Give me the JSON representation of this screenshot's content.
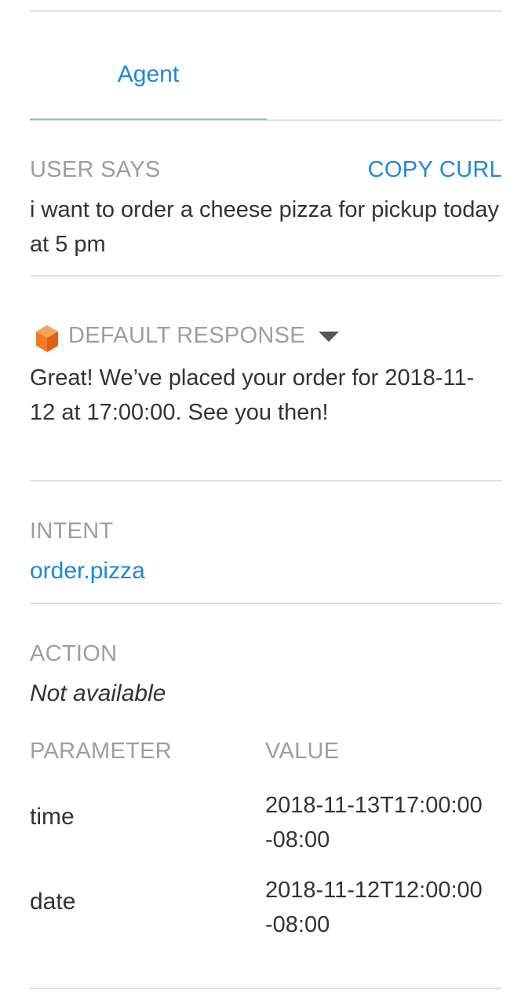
{
  "tabs": {
    "active": "Agent"
  },
  "user_says": {
    "label": "USER SAYS",
    "copy_curl": "COPY CURL",
    "text": "i want to order a cheese pizza for pickup today at 5 pm"
  },
  "response": {
    "label": "DEFAULT RESPONSE",
    "icon": "dialogflow-cube-icon",
    "text": "Great! We’ve placed your order for 2018-11-12 at 17:00:00. See you then!"
  },
  "intent": {
    "label": "INTENT",
    "value": "order.pizza"
  },
  "action": {
    "label": "ACTION",
    "value": "Not available"
  },
  "parameters": {
    "col_parameter": "PARAMETER",
    "col_value": "VALUE",
    "rows": [
      {
        "name": "time",
        "value_line1": "2018-11-13T17:00:00",
        "value_line2": "-08:00"
      },
      {
        "name": "date",
        "value_line1": "2018-11-12T12:00:00",
        "value_line2": "-08:00"
      }
    ]
  },
  "colors": {
    "accent": "#1e88d6",
    "muted": "#9e9e9e",
    "icon_orange": "#f27b22"
  }
}
